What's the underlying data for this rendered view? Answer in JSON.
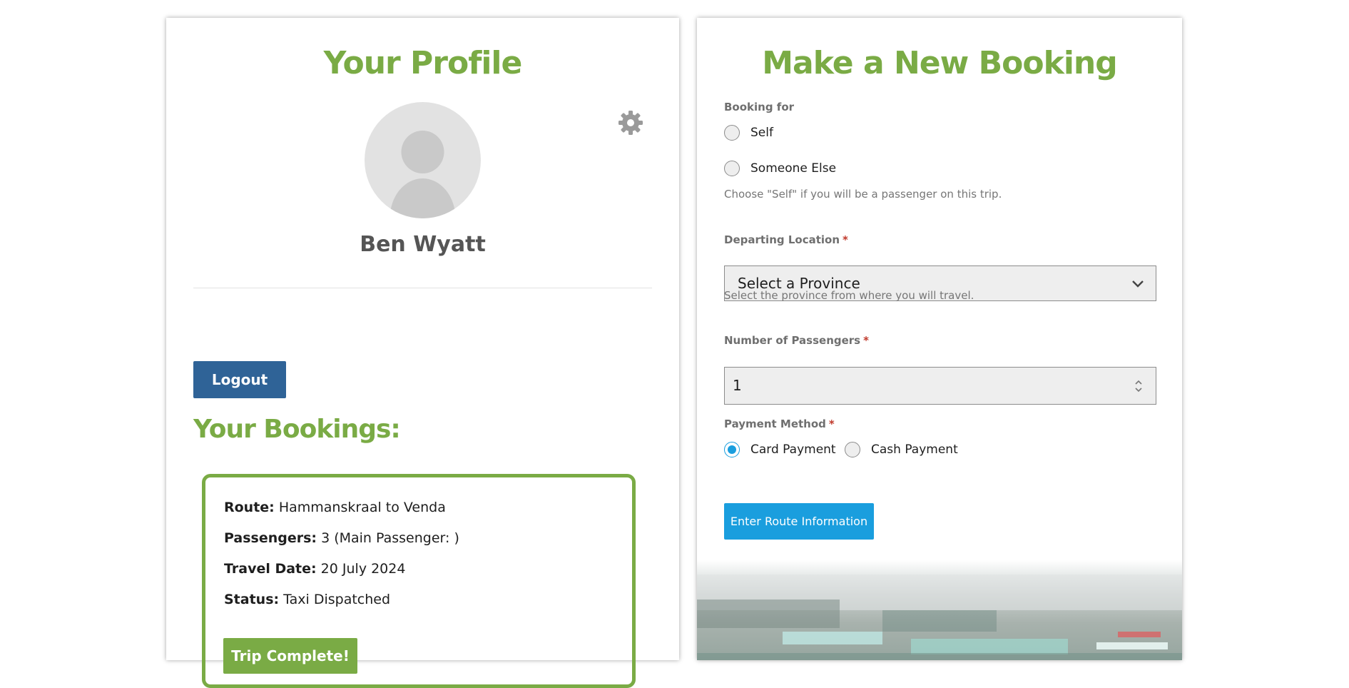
{
  "profile": {
    "title": "Your Profile",
    "user_name": "Ben Wyatt",
    "logout_label": "Logout",
    "bookings_title": "Your Bookings:",
    "booking": {
      "route_label": "Route:",
      "route_value": "Hammanskraal to Venda",
      "passengers_label": "Passengers:",
      "passengers_value": "3 (Main Passenger: )",
      "travel_date_label": "Travel Date:",
      "travel_date_value": "20 July 2024",
      "status_label": "Status:",
      "status_value": "Taxi Dispatched",
      "action_label": "Trip Complete!"
    }
  },
  "booking_form": {
    "title": "Make a New Booking",
    "booking_for": {
      "label": "Booking for",
      "options": [
        "Self",
        "Someone Else"
      ],
      "help": "Choose \"Self\" if you will be a passenger on this trip."
    },
    "departing": {
      "label": "Departing Location",
      "required_mark": "*",
      "selected": "Select a Province",
      "help": "Select the province from where you will travel."
    },
    "passengers": {
      "label": "Number of Passengers",
      "required_mark": "*",
      "value": "1"
    },
    "payment": {
      "label": "Payment Method",
      "required_mark": "*",
      "options": [
        "Card Payment",
        "Cash Payment"
      ],
      "selected": "Card Payment"
    },
    "submit_label": "Enter Route Information"
  },
  "colors": {
    "accent_green": "#7aab45",
    "logout_blue": "#2f6397",
    "action_blue": "#1a9ede",
    "required_red": "#c0392b"
  },
  "icons": {
    "settings": "gear-icon",
    "avatar": "user-placeholder-icon",
    "select": "chevron-down-icon",
    "spinner": "up-down-arrows-icon"
  }
}
